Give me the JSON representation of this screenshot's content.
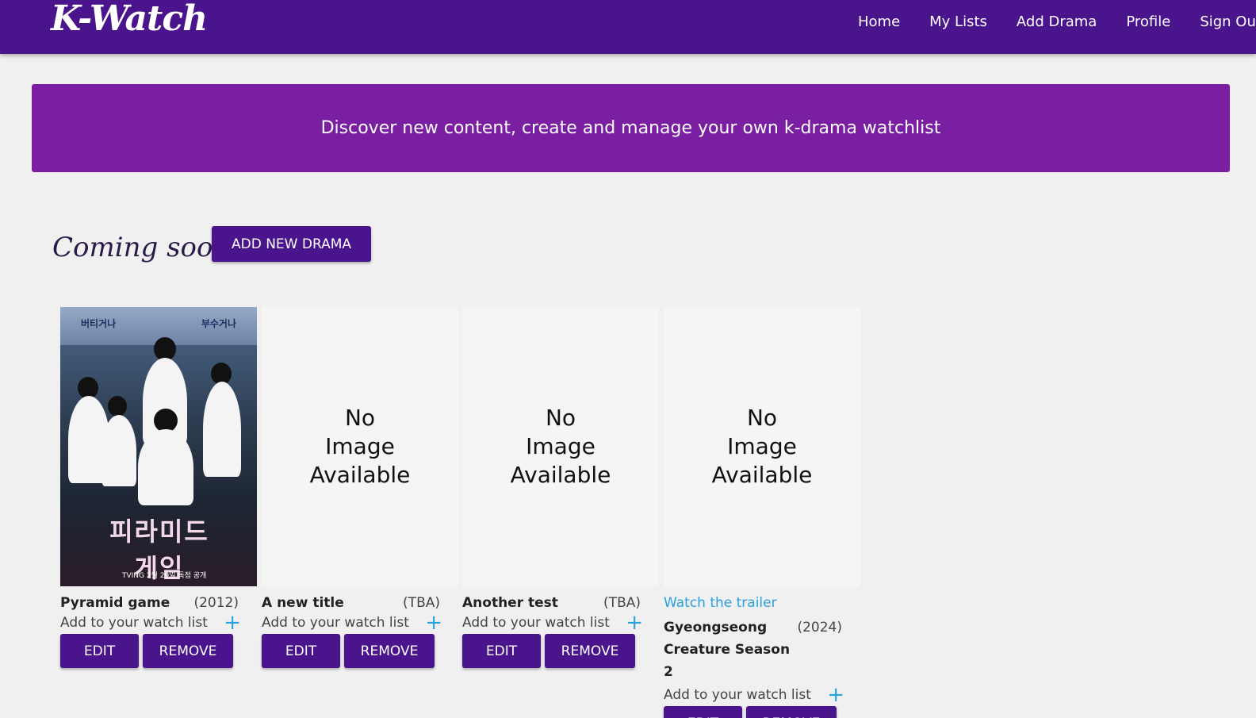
{
  "brand": "K-Watch",
  "nav": [
    "Home",
    "My Lists",
    "Add Drama",
    "Profile",
    "Sign Out"
  ],
  "hero_text": "Discover new content, create and manage your own k-drama watchlist",
  "section_title": "Coming soon",
  "add_new_label": "ADD NEW DRAMA",
  "no_image": [
    "No",
    "Image",
    "Available"
  ],
  "watch_label": "Add to your watch list",
  "plus": "+",
  "edit_label": "EDIT",
  "remove_label": "REMOVE",
  "trailer_label": "Watch the trailer",
  "poster_text": {
    "left": "버티거나",
    "right": "부수거나",
    "logo": "피라미드 게임",
    "foot": "TVING 2월 29일 독점 공개"
  },
  "dramas": [
    {
      "title": "Pyramid game",
      "year": "(2012)",
      "has_image": true,
      "trailer": false
    },
    {
      "title": "A new title",
      "year": "(TBA)",
      "has_image": false,
      "trailer": false
    },
    {
      "title": "Another test",
      "year": "(TBA)",
      "has_image": false,
      "trailer": false
    },
    {
      "title": "Gyeongseong Creature Season 2",
      "year": "(2024)",
      "has_image": false,
      "trailer": true
    }
  ],
  "colors": {
    "navbar": "#4a148c",
    "hero": "#7b1fa2",
    "button": "#4a148c",
    "link": "#29a0e0",
    "background": "#f0f0f0"
  }
}
